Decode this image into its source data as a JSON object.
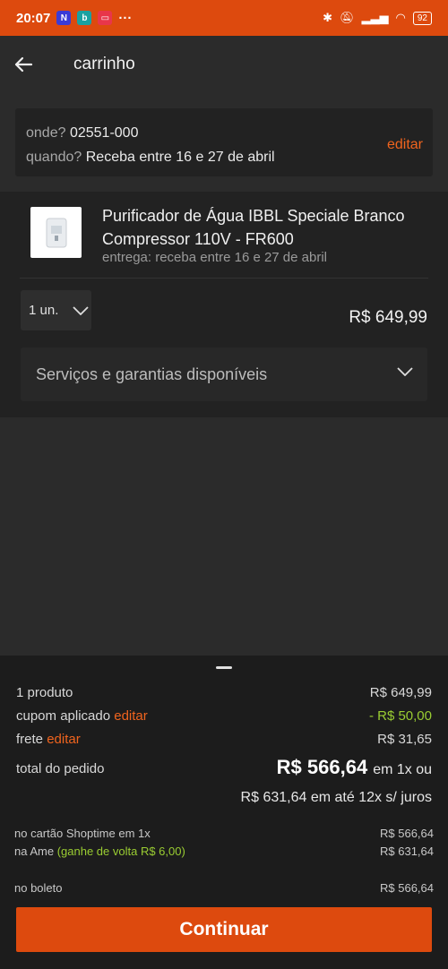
{
  "status_bar": {
    "time": "20:07",
    "more": "···",
    "battery": "92"
  },
  "header": {
    "title": "carrinho"
  },
  "address": {
    "where_label": "onde?",
    "where_value": "02551-000",
    "when_label": "quando?",
    "when_value": "Receba entre 16 e 27 de abril",
    "edit_label": "editar"
  },
  "product": {
    "name": "Purificador de Água IBBL Speciale Branco Compressor 110V - FR600",
    "delivery": "entrega: receba entre 16 e 27 de abril",
    "quantity": "1 un.",
    "price": "R$ 649,99",
    "services_label": "Serviços e garantias disponíveis"
  },
  "summary": {
    "products_label": "1 produto",
    "products_value": "R$ 649,99",
    "coupon_label": "cupom aplicado",
    "coupon_edit": "editar",
    "coupon_value": "- R$ 50,00",
    "shipping_label": "frete",
    "shipping_edit": "editar",
    "shipping_value": "R$ 31,65",
    "total_label": "total do pedido",
    "total_value": "R$ 566,64",
    "total_suffix": "em 1x ou",
    "installments": "R$ 631,64 em até 12x s/ juros",
    "card_label": "no cartão Shoptime em 1x",
    "card_value": "R$ 566,64",
    "ame_label": "na Ame",
    "ame_cashback": "(ganhe de volta R$ 6,00)",
    "ame_value": "R$ 631,64",
    "boleto_label": "no boleto",
    "boleto_value": "R$ 566,64"
  },
  "actions": {
    "continue_label": "Continuar"
  },
  "colors": {
    "accent": "#dd4a0e",
    "link": "#f0641e",
    "discount": "#9acd32"
  }
}
